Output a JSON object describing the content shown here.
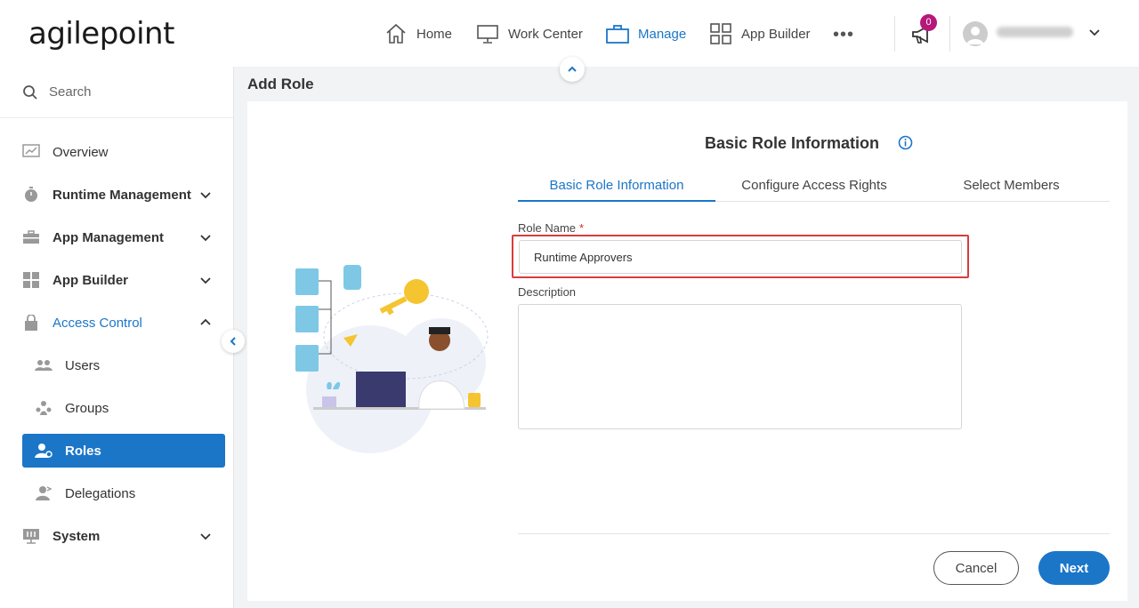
{
  "brand": {
    "logo_text": "agilepoint"
  },
  "top_nav": {
    "items": [
      {
        "label": "Home",
        "icon": "home-icon"
      },
      {
        "label": "Work Center",
        "icon": "monitor-icon"
      },
      {
        "label": "Manage",
        "icon": "briefcase-icon",
        "active": true
      },
      {
        "label": "App Builder",
        "icon": "grid-icon"
      }
    ],
    "more_label": "•••",
    "notification_count": "0"
  },
  "sidebar": {
    "search_placeholder": "Search",
    "items": [
      {
        "label": "Overview",
        "icon": "chart-icon"
      },
      {
        "label": "Runtime Management",
        "icon": "timer-icon"
      },
      {
        "label": "App Management",
        "icon": "toolbox-icon"
      },
      {
        "label": "App Builder",
        "icon": "grid-icon"
      },
      {
        "label": "Access Control",
        "icon": "lock-icon"
      },
      {
        "label": "Users",
        "icon": "users-icon"
      },
      {
        "label": "Groups",
        "icon": "groups-icon"
      },
      {
        "label": "Roles",
        "icon": "role-icon"
      },
      {
        "label": "Delegations",
        "icon": "delegation-icon"
      },
      {
        "label": "System",
        "icon": "system-icon"
      }
    ]
  },
  "page": {
    "title": "Add Role",
    "section_title": "Basic Role Information",
    "tabs": [
      {
        "label": "Basic Role Information",
        "active": true
      },
      {
        "label": "Configure Access Rights"
      },
      {
        "label": "Select Members"
      }
    ],
    "form": {
      "role_name_label": "Role Name",
      "required_mark": "*",
      "role_name_value": "Runtime Approvers",
      "description_label": "Description",
      "description_value": ""
    },
    "buttons": {
      "cancel": "Cancel",
      "next": "Next"
    }
  },
  "colors": {
    "accent": "#1b76c8",
    "highlight": "#d93c3c",
    "badge": "#b5197a"
  }
}
